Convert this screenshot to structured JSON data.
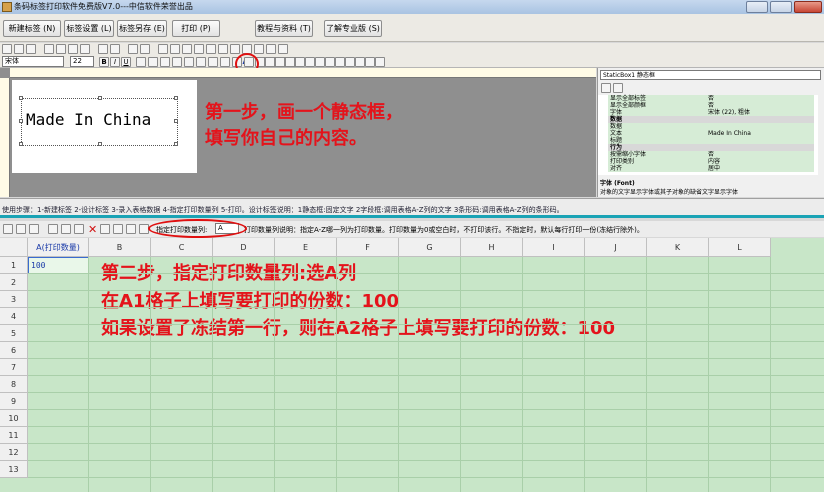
{
  "window": {
    "title": "条码标签打印软件免费版V7.0---中信软件荣誉出品"
  },
  "menu": {
    "new_label": "新建标签 (N)",
    "label_settings": "标签设置 (L)",
    "save_as": "标签另存 (E)",
    "print": "打印 (P)",
    "tutorial": "教程与资料 (T)",
    "pro": "了解专业版 (S)"
  },
  "format_toolbar": {
    "font": "宋体",
    "size": "22",
    "highlighted_icon": "A"
  },
  "canvas": {
    "static_text": "Made In China"
  },
  "notes": {
    "step1_line1": "第一步，画一个静态框，",
    "step1_line2": "填写你自己的内容。",
    "step2_line1": "第二步，指定打印数量列:选A列",
    "step2_line2": "在A1格子上填写要打印的份数：100",
    "step2_line3": "如果设置了冻结第一行，则在A2格子上填写要打印的份数：100"
  },
  "properties": {
    "object_select": "StaticBox1 静态框",
    "rows": [
      {
        "name": "显示全部标签",
        "value": "否"
      },
      {
        "name": "显示全部颜框",
        "value": "否"
      },
      {
        "name": "字体",
        "value": "宋体 (22), 粗体"
      },
      {
        "name": "数据",
        "value": "",
        "group": true
      },
      {
        "name": "数据",
        "value": ""
      },
      {
        "name": "文本",
        "value": "Made In China"
      },
      {
        "name": "标题",
        "value": ""
      },
      {
        "name": "行为",
        "value": "",
        "group": true
      },
      {
        "name": "按需缩小字体",
        "value": "否"
      },
      {
        "name": "打印类别",
        "value": "内容"
      },
      {
        "name": "对齐",
        "value": "居中"
      }
    ],
    "desc_title": "字体 (Font)",
    "desc_text": "对象的文字显示字体或其子对象的缺省文字显示字体"
  },
  "status_line": "使用步骤：1-新建标签 2-设计标签 3-录入表格数据 4-指定打印数量列 5-打印。设计标签说明：1静态框:固定文字 2字段框:调用表格A-Z列的文字 3条形码:调用表格A-Z列的条形码。",
  "grid_toolbar": {
    "qty_label": "指定打印数量列:",
    "qty_value": "A",
    "help": "打印数量列说明：指定A-Z哪一列为打印数量。打印数量为0或空白时，不打印该行。不指定时，默认每行打印一份(冻结行除外)。"
  },
  "spreadsheet": {
    "columns": [
      "A(打印数量)",
      "B",
      "C",
      "D",
      "E",
      "F",
      "G",
      "H",
      "I",
      "J",
      "K",
      "L"
    ],
    "rows": [
      "1",
      "2",
      "3",
      "4",
      "5",
      "6",
      "7",
      "8",
      "9",
      "10",
      "11",
      "12",
      "13"
    ],
    "a1_value": "100"
  },
  "colors": {
    "accent_red": "#e4131b",
    "grid_bg": "#c8e6c8",
    "teal_line": "#1aa3b5"
  }
}
